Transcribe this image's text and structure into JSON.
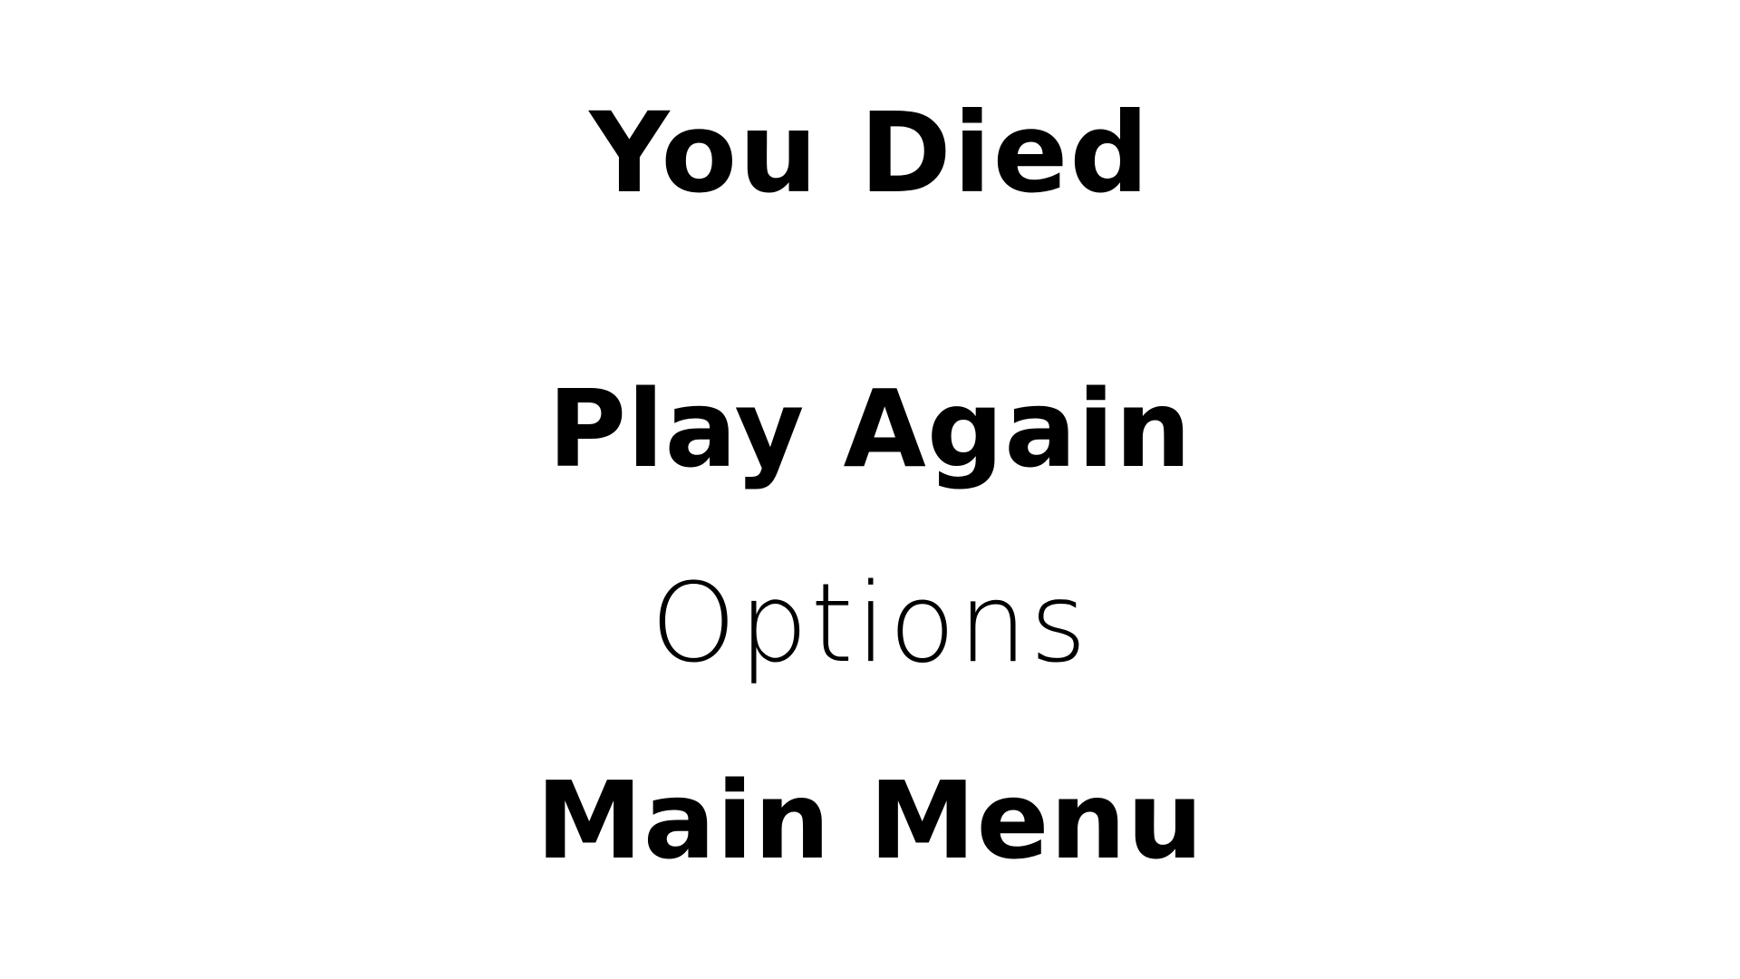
{
  "screen": {
    "title": "You Died",
    "menu": {
      "play_again": "Play Again",
      "options": "Options",
      "main_menu": "Main Menu"
    },
    "colors": {
      "background": "#ffffff",
      "text": "#000000"
    },
    "selected_item": "Options"
  }
}
